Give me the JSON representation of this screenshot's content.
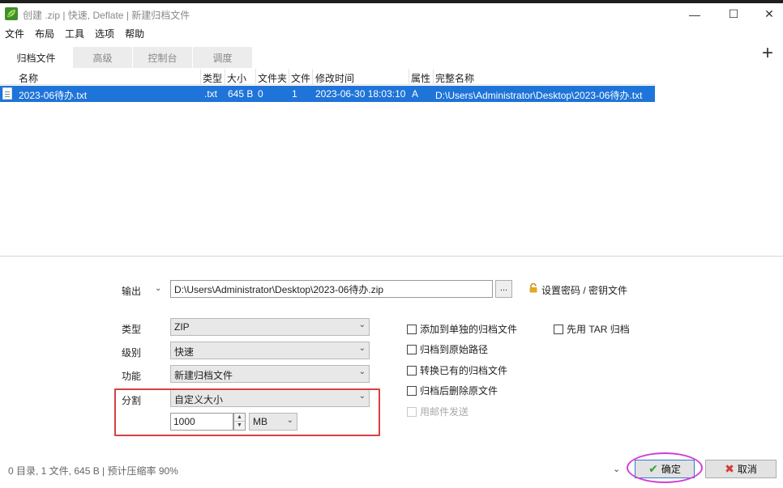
{
  "window": {
    "title": "创建 .zip | 快速, Deflate | 新建归档文件",
    "icon": "peazip-leaf-icon",
    "minimize": "—",
    "maximize": "☐",
    "close": "✕"
  },
  "menu": [
    "文件",
    "布局",
    "工具",
    "选项",
    "帮助"
  ],
  "tabs": [
    "归档文件",
    "高级",
    "控制台",
    "调度"
  ],
  "add_button": "+",
  "list": {
    "columns": [
      "名称",
      "类型",
      "大小",
      "文件夹",
      "文件",
      "修改时间",
      "属性",
      "完整名称"
    ],
    "rows": [
      {
        "name": "2023-06待办.txt",
        "type": ".txt",
        "size": "645 B",
        "folders": "0",
        "files": "1",
        "modified": "2023-06-30 18:03:10",
        "attr": "A",
        "fullname": "D:\\Users\\Administrator\\Desktop\\2023-06待办.txt"
      }
    ]
  },
  "output": {
    "label": "输出",
    "value": "D:\\Users\\Administrator\\Desktop\\2023-06待办.zip",
    "browse": "...",
    "password_link": "设置密码 / 密钥文件"
  },
  "options": {
    "type_label": "类型",
    "type_value": "ZIP",
    "level_label": "级别",
    "level_value": "快速",
    "function_label": "功能",
    "function_value": "新建归档文件",
    "split_label": "分割",
    "split_value": "自定义大小",
    "split_size": "1000",
    "split_unit": "MB"
  },
  "checkboxes": {
    "add_separate": "添加到单独的归档文件",
    "tar_first": "先用 TAR 归档",
    "archive_original_path": "归档到原始路径",
    "convert_existing": "转换已有的归档文件",
    "delete_after": "归档后删除原文件",
    "send_mail": "用邮件发送"
  },
  "status": "0 目录,  1 文件,  645 B | 预计压缩率 90%",
  "buttons": {
    "ok": "确定",
    "cancel": "取消"
  },
  "colors": {
    "selection": "#1e74d8",
    "highlight_box": "#d84040",
    "highlight_ring": "#d33cd8"
  }
}
